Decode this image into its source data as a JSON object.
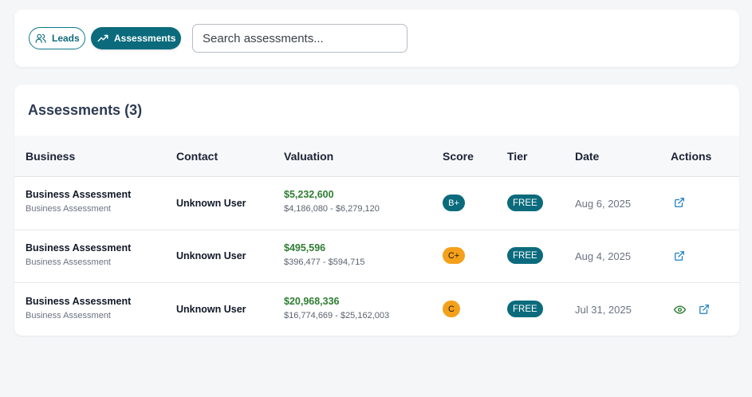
{
  "nav": {
    "leads_label": "Leads",
    "assessments_label": "Assessments",
    "search_placeholder": "Search assessments...",
    "search_value": ""
  },
  "card": {
    "title": "Assessments (3)"
  },
  "table": {
    "headers": {
      "business": "Business",
      "contact": "Contact",
      "valuation": "Valuation",
      "score": "Score",
      "tier": "Tier",
      "date": "Date",
      "actions": "Actions"
    },
    "rows": [
      {
        "business": "Business Assessment",
        "business_sub": "Business Assessment",
        "contact": "Unknown User",
        "valuation": "$5,232,600",
        "valuation_range": "$4,186,080 - $6,279,120",
        "score": "B+",
        "tier": "FREE",
        "date": "Aug 6, 2025",
        "actions": [
          "external-link-icon"
        ]
      },
      {
        "business": "Business Assessment",
        "business_sub": "Business Assessment",
        "contact": "Unknown User",
        "valuation": "$495,596",
        "valuation_range": "$396,477 - $594,715",
        "score": "C+",
        "tier": "FREE",
        "date": "Aug 4, 2025",
        "actions": [
          "external-link-icon"
        ]
      },
      {
        "business": "Business Assessment",
        "business_sub": "Business Assessment",
        "contact": "Unknown User",
        "valuation": "$20,968,336",
        "valuation_range": "$16,774,669 - $25,162,003",
        "score": "C",
        "tier": "FREE",
        "date": "Jul 31, 2025",
        "actions": [
          "eye-icon",
          "external-link-icon"
        ]
      }
    ]
  },
  "colors": {
    "accent": "#0b6b7d",
    "score_b": "#0b6b7d",
    "score_c": "#f5a01a",
    "valuation": "#2e7d32",
    "view_icon": "#2e7d32",
    "link_icon": "#1f7fc4"
  }
}
